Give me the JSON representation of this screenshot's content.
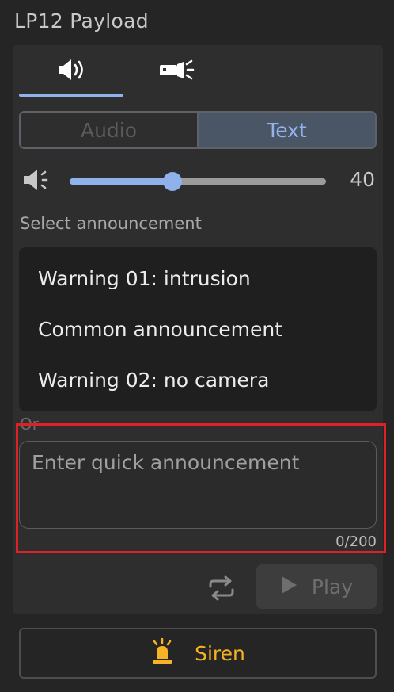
{
  "window": {
    "title": "LP12 Payload"
  },
  "tabs": [
    {
      "icon": "speaker-icon",
      "active": true
    },
    {
      "icon": "spotlight-icon",
      "active": false
    }
  ],
  "mode_toggle": {
    "options": [
      "Audio",
      "Text"
    ],
    "selected": "Text"
  },
  "volume": {
    "icon": "volume-icon",
    "value": 40,
    "max": 100,
    "display": "40"
  },
  "announcement": {
    "label": "Select announcement",
    "items": [
      "Warning 01: intrusion",
      "Common announcement",
      "Warning 02: no camera"
    ]
  },
  "quick": {
    "or_label": "Or",
    "placeholder": "Enter quick announcement",
    "counter": "0/200"
  },
  "actions": {
    "loop_icon": "repeat-icon",
    "play_label": "Play"
  },
  "siren": {
    "label": "Siren",
    "icon": "beacon-icon",
    "color": "#f6b424"
  },
  "colors": {
    "accent": "#8fb1ec",
    "highlight": "#de2028"
  }
}
